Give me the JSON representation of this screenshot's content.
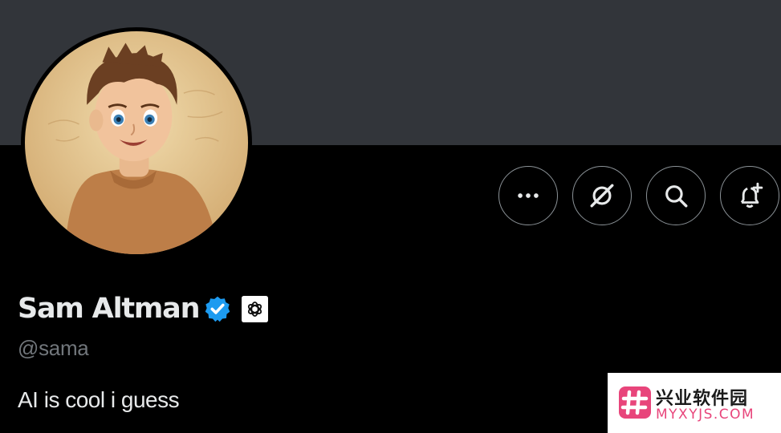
{
  "profile": {
    "display_name": "Sam Altman",
    "handle": "@sama",
    "bio": "AI is cool i guess"
  },
  "icons": {
    "verified": "verified-badge-icon",
    "affiliation": "openai-logo-icon",
    "more": "more-icon",
    "grok": "grok-icon",
    "search": "search-icon",
    "notify": "bell-plus-icon"
  },
  "colors": {
    "banner": "#32353a",
    "background": "#000000",
    "text_primary": "#e7e9ea",
    "text_secondary": "#71767b",
    "verified_blue": "#1d9bf0",
    "button_border": "#8b9297",
    "watermark_accent": "#e8457b"
  },
  "watermark": {
    "title": "兴业软件园",
    "url": "MYXYJS.COM"
  }
}
